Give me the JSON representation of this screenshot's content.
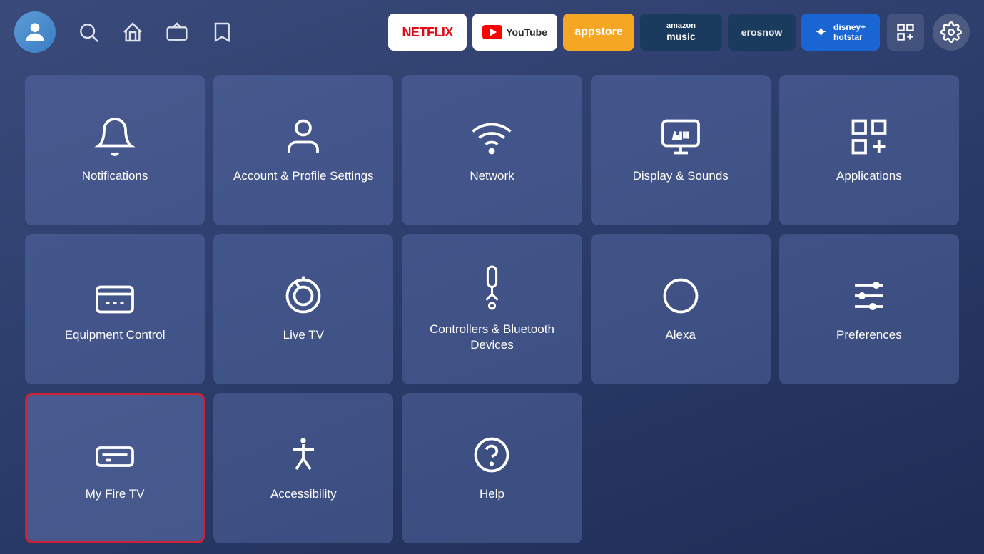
{
  "header": {
    "nav_items": [
      "search",
      "home",
      "tv",
      "bookmark"
    ],
    "apps": [
      {
        "id": "netflix",
        "label": "NETFLIX",
        "type": "netflix"
      },
      {
        "id": "youtube",
        "label": "YouTube",
        "type": "youtube"
      },
      {
        "id": "appstore",
        "label": "appstore",
        "type": "appstore"
      },
      {
        "id": "amazon-music",
        "label": "amazon music",
        "type": "amazon-music"
      },
      {
        "id": "erosnow",
        "label": "erosnow",
        "type": "erosnow"
      },
      {
        "id": "hotstar",
        "label": "disney+ hotstar",
        "type": "hotstar"
      }
    ],
    "right_icons": [
      "grid-icon",
      "settings-icon"
    ]
  },
  "grid": {
    "items": [
      {
        "id": "notifications",
        "label": "Notifications",
        "icon": "bell"
      },
      {
        "id": "account-profile",
        "label": "Account & Profile Settings",
        "icon": "user"
      },
      {
        "id": "network",
        "label": "Network",
        "icon": "wifi"
      },
      {
        "id": "display-sounds",
        "label": "Display & Sounds",
        "icon": "monitor"
      },
      {
        "id": "applications",
        "label": "Applications",
        "icon": "grid-apps"
      },
      {
        "id": "equipment-control",
        "label": "Equipment Control",
        "icon": "monitor-desktop"
      },
      {
        "id": "live-tv",
        "label": "Live TV",
        "icon": "broadcast"
      },
      {
        "id": "controllers-bluetooth",
        "label": "Controllers & Bluetooth Devices",
        "icon": "remote"
      },
      {
        "id": "alexa",
        "label": "Alexa",
        "icon": "alexa"
      },
      {
        "id": "preferences",
        "label": "Preferences",
        "icon": "sliders"
      },
      {
        "id": "my-fire-tv",
        "label": "My Fire TV",
        "icon": "fire-tv",
        "selected": true
      },
      {
        "id": "accessibility",
        "label": "Accessibility",
        "icon": "accessibility"
      },
      {
        "id": "help",
        "label": "Help",
        "icon": "help"
      }
    ]
  }
}
